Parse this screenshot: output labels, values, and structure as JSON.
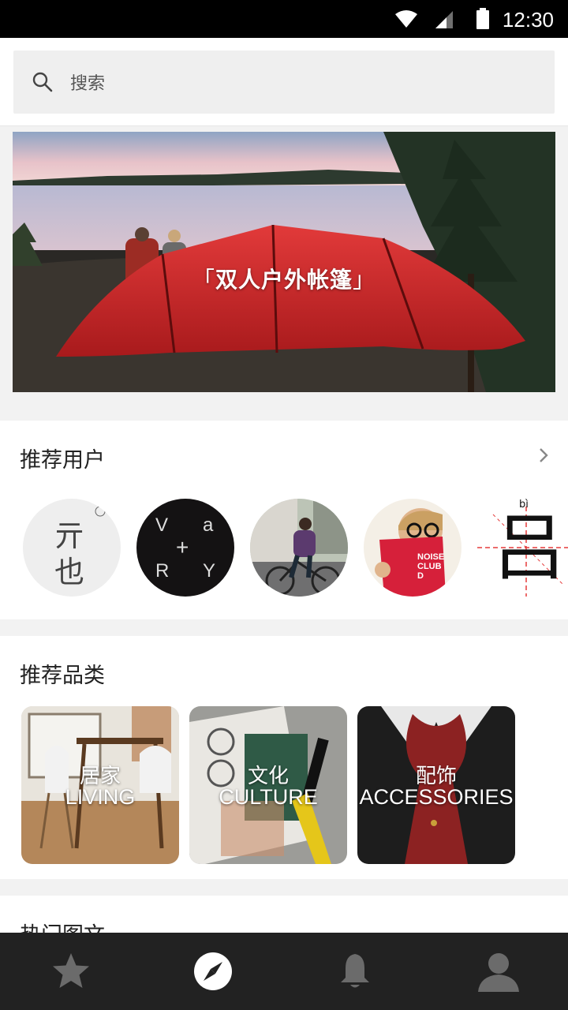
{
  "status_bar": {
    "time": "12:30"
  },
  "search": {
    "placeholder": "搜索",
    "icon": "search-icon"
  },
  "banner": {
    "title": "双人户外帐篷",
    "bracket_open": "「",
    "bracket_close": "」"
  },
  "recommended_users": {
    "title": "推荐用户",
    "more_icon": "chevron-right-icon",
    "users": [
      {
        "label_top": "亓",
        "label_bottom": "也"
      },
      {
        "letters": [
          "V",
          "a",
          "R",
          "Y"
        ]
      },
      {
        "label": "cyclist"
      },
      {
        "book_text": "NOISE CLUB D"
      },
      {
        "pinyin": "bì",
        "char": "吕"
      }
    ]
  },
  "recommended_categories": {
    "title": "推荐品类",
    "items": [
      {
        "zh": "居家",
        "en": "LIVING"
      },
      {
        "zh": "文化",
        "en": "CULTURE"
      },
      {
        "zh": "配饰",
        "en": "ACCESSORIES"
      }
    ]
  },
  "hot_articles": {
    "title": "热门图文"
  },
  "tab_bar": {
    "tabs": [
      {
        "name": "favorites",
        "icon": "star-icon",
        "active": false
      },
      {
        "name": "discover",
        "icon": "compass-icon",
        "active": true
      },
      {
        "name": "notifications",
        "icon": "bell-icon",
        "active": false
      },
      {
        "name": "profile",
        "icon": "person-icon",
        "active": false
      }
    ]
  },
  "colors": {
    "tab_bar_bg": "#222222",
    "tab_inactive": "#6b6b6b",
    "tab_active": "#ffffff",
    "banner_tent": "#d42a2a"
  }
}
